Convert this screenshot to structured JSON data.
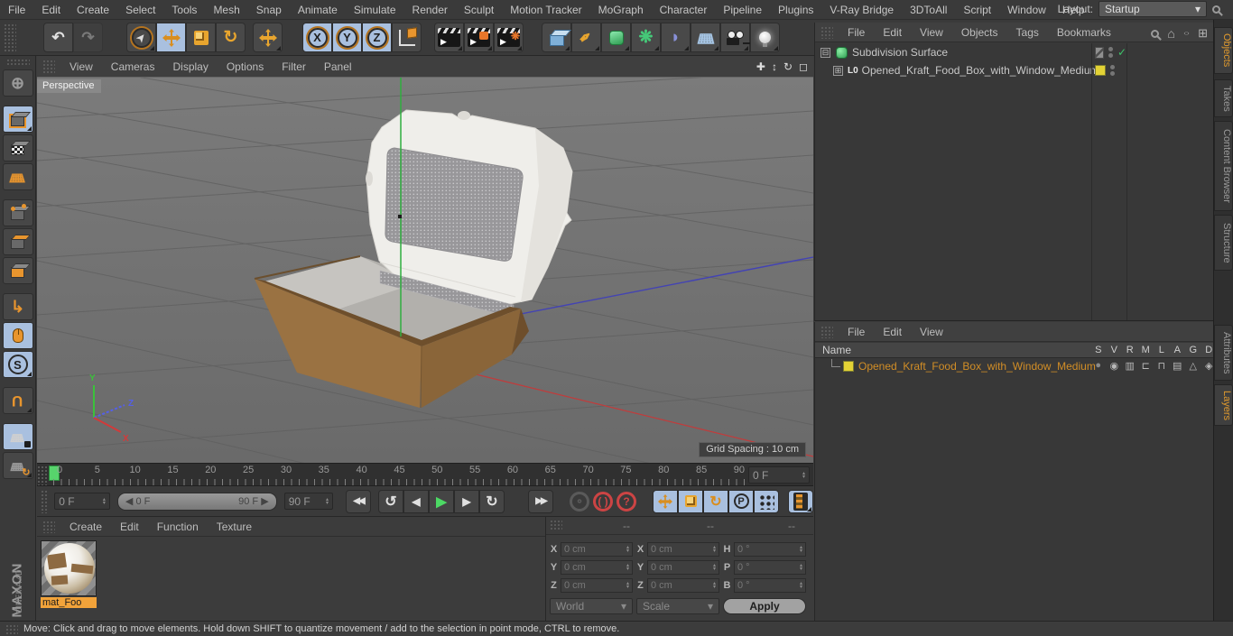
{
  "app": {
    "layout_label": "Layout:",
    "layout_value": "Startup"
  },
  "menu_bar": {
    "items": [
      "File",
      "Edit",
      "Create",
      "Select",
      "Tools",
      "Mesh",
      "Snap",
      "Animate",
      "Simulate",
      "Render",
      "Sculpt",
      "Motion Tracker",
      "MoGraph",
      "Character",
      "Pipeline",
      "Plugins",
      "V-Ray Bridge",
      "3DToAll",
      "Script",
      "Window",
      "Help"
    ]
  },
  "viewport": {
    "menus": [
      "View",
      "Cameras",
      "Display",
      "Options",
      "Filter",
      "Panel"
    ],
    "view_label": "Perspective",
    "grid_spacing_label": "Grid Spacing : 10 cm",
    "axis": {
      "x": "X",
      "y": "Y",
      "z": "Z"
    }
  },
  "object_manager": {
    "menus": [
      "File",
      "Edit",
      "View",
      "Objects",
      "Tags",
      "Bookmarks"
    ],
    "objects": [
      {
        "name": "Subdivision Surface"
      },
      {
        "name": "Opened_Kraft_Food_Box_with_Window_Medium"
      }
    ]
  },
  "side_tabs": {
    "top": [
      "Objects",
      "Takes",
      "Content Browser",
      "Structure"
    ],
    "bottom": [
      "Attributes",
      "Layers"
    ]
  },
  "layer_panel": {
    "menus": [
      "File",
      "Edit",
      "View"
    ],
    "name_header": "Name",
    "columns": [
      "S",
      "V",
      "R",
      "M",
      "L",
      "A",
      "G",
      "D"
    ],
    "rows": [
      {
        "name": "Opened_Kraft_Food_Box_with_Window_Medium"
      }
    ]
  },
  "material_manager": {
    "menus": [
      "Create",
      "Edit",
      "Function",
      "Texture"
    ],
    "materials": [
      {
        "name": "mat_Foo"
      }
    ]
  },
  "timeline": {
    "ticks": [
      "0",
      "5",
      "10",
      "15",
      "20",
      "25",
      "30",
      "35",
      "40",
      "45",
      "50",
      "55",
      "60",
      "65",
      "70",
      "75",
      "80",
      "85",
      "90"
    ],
    "frame_field": "0 F"
  },
  "transport": {
    "current_frame": "0 F",
    "range_start": "0 F",
    "range_end": "90 F",
    "end_frame": "90 F"
  },
  "coordinates": {
    "headers": [
      "--",
      "--",
      "--"
    ],
    "position": [
      {
        "label": "X",
        "value": "0 cm"
      },
      {
        "label": "Y",
        "value": "0 cm"
      },
      {
        "label": "Z",
        "value": "0 cm"
      }
    ],
    "scale": [
      {
        "label": "X",
        "value": "0 cm"
      },
      {
        "label": "Y",
        "value": "0 cm"
      },
      {
        "label": "Z",
        "value": "0 cm"
      }
    ],
    "rotation": [
      {
        "label": "H",
        "value": "0 °"
      },
      {
        "label": "P",
        "value": "0 °"
      },
      {
        "label": "B",
        "value": "0 °"
      }
    ],
    "world_label": "World",
    "scale_mode_label": "Scale",
    "apply_label": "Apply"
  },
  "status_bar": {
    "text": "Move: Click and drag to move elements. Hold down SHIFT to quantize movement / add to the selection in point mode, CTRL to remove."
  },
  "branding": {
    "logo_text": "MAXON",
    "product_text": "CINEMA 4D"
  },
  "icons": {
    "undo": "↶",
    "redo": "↷",
    "pointer": "➤",
    "rotate": "↻",
    "axis_x": "X",
    "axis_y": "Y",
    "axis_z": "Z",
    "play": "▶",
    "prev_frame": "◀",
    "next_frame": "▶",
    "go_start": "◀◀",
    "go_end": "▶▶",
    "prev_key": "↺",
    "next_key": "↻",
    "question": "?",
    "p_key": "P",
    "s_snap": "S",
    "home": "⌂",
    "eye": "○",
    "add_box": "⊞",
    "collapse": "⊟",
    "expand": "⊞",
    "check": "✓",
    "pen": "✒",
    "flower": "❋",
    "bend": "◗",
    "floor_grid": "▦",
    "gear": "❋",
    "cam_pan": "✚",
    "cam_zoom": "↕",
    "cam_rotate": "↻",
    "cam_max": "◻",
    "dropdown": "▾",
    "spin_up": "▴",
    "spin_down": "▾",
    "range_left": "◀",
    "range_right": "▶",
    "lod": "L0",
    "lb_globe": "⊕",
    "lb_grid": "▦",
    "lb_axis": "↳",
    "lb_magnet": "U",
    "tg_dot": "●",
    "tg_eye": "◉",
    "tg_film": "▥",
    "tg_mgr": "⊏",
    "tg_lock": "⊓",
    "tg_list": "▤",
    "tg_pyr": "△",
    "tg_d": "◈"
  },
  "colors": {
    "accent_orange": "#E8951E",
    "active_blue": "#A9C0DF",
    "selected_text": "#D28E26",
    "viewport_bg": "#6E6E6E",
    "play_green": "#4CD964",
    "check_green": "#39B54A",
    "swatch_yellow": "#E3D235",
    "material_label_bg": "#F2A33A"
  }
}
